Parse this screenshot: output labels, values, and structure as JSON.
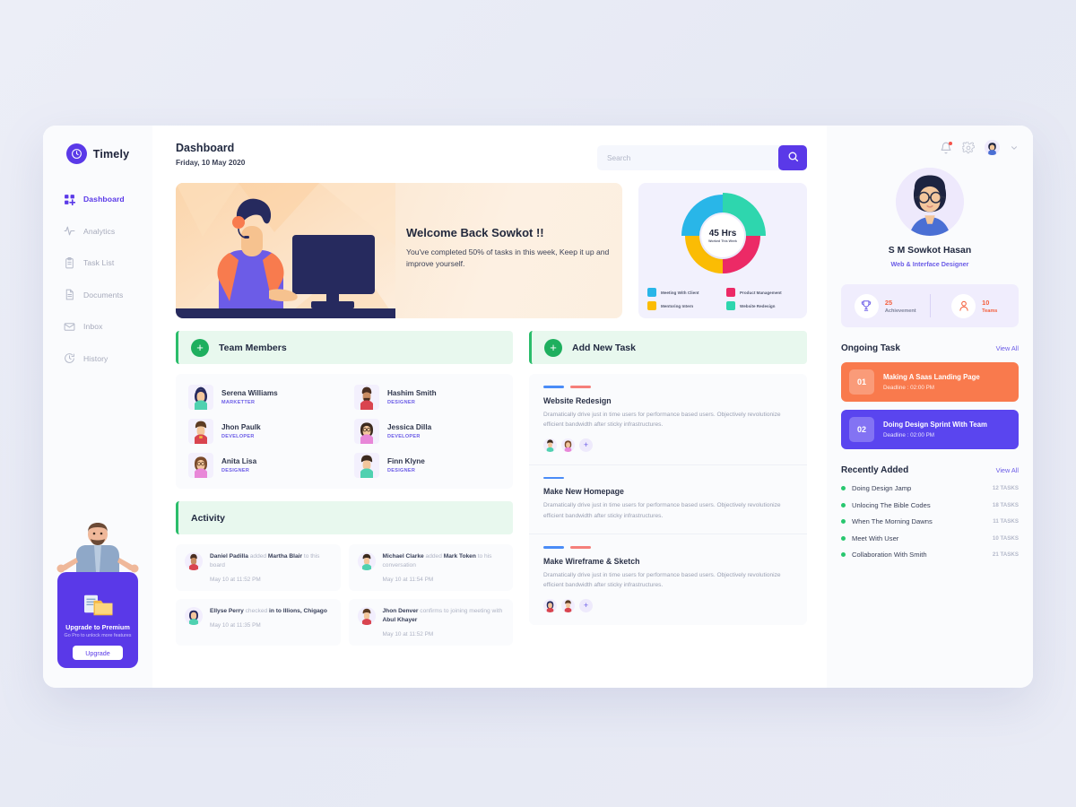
{
  "brand": {
    "name": "Timely",
    "logo_icon": "clock-icon",
    "color": "#5a39e8"
  },
  "sidebar": {
    "items": [
      {
        "label": "Dashboard",
        "icon": "grid-add-icon",
        "active": true
      },
      {
        "label": "Analytics",
        "icon": "pulse-icon",
        "active": false
      },
      {
        "label": "Task List",
        "icon": "clipboard-icon",
        "active": false
      },
      {
        "label": "Documents",
        "icon": "document-icon",
        "active": false
      },
      {
        "label": "Inbox",
        "icon": "envelope-icon",
        "active": false
      },
      {
        "label": "History",
        "icon": "history-clock-icon",
        "active": false
      }
    ],
    "upgrade": {
      "title": "Upgrade to Premium",
      "subtitle": "Go Pro to unlock more features",
      "button": "Upgrade",
      "illustration": "shrugging-man-illustration",
      "icon": "folder-documents-icon"
    }
  },
  "header": {
    "title": "Dashboard",
    "date": "Friday, 10 May 2020",
    "search": {
      "placeholder": "Search",
      "value": "",
      "button_icon": "search-icon"
    }
  },
  "welcome": {
    "heading": "Welcome Back Sowkot !!",
    "body": "You've completed 50% of tasks in this week, Keep it up and improve yourself.",
    "illustration": "man-at-computer-illustration"
  },
  "chart_data": {
    "type": "pie",
    "title": "45 Hrs",
    "subtitle": "Worked This Week",
    "center_value": "45 Hrs",
    "center_label": "Worked This Week",
    "categories": [
      "Meeting With Client",
      "Mentoring Intern",
      "Product Management",
      "Website Redesign"
    ],
    "values": [
      25,
      25,
      25,
      25
    ],
    "colors": [
      "#29b6e8",
      "#fbbc04",
      "#ec2a66",
      "#2ed6ae"
    ],
    "legend_position": "bottom",
    "grid": false,
    "donut": true
  },
  "team": {
    "section_title": "Team Members",
    "add_icon": "plus-icon",
    "members": [
      {
        "name": "Serena Williams",
        "role": "MARKETTER",
        "avatar": "avatar-female-teal"
      },
      {
        "name": "Hashim Smith",
        "role": "DESIGNER",
        "avatar": "avatar-male-red-beard"
      },
      {
        "name": "Jhon Paulk",
        "role": "DEVELOPER",
        "avatar": "avatar-male-red"
      },
      {
        "name": "Jessica Dilla",
        "role": "DEVELOPER",
        "avatar": "avatar-female-pink-glasses"
      },
      {
        "name": "Anita Lisa",
        "role": "DESIGNER",
        "avatar": "avatar-female-pink"
      },
      {
        "name": "Finn Klyne",
        "role": "DESIGNER",
        "avatar": "avatar-male-teal"
      }
    ]
  },
  "activity": {
    "section_title": "Activity",
    "items": [
      {
        "actor": "Daniel Padilla",
        "action": "added",
        "target": "Martha Blair",
        "suffix": "to this board",
        "time": "May 10 at 11:52 PM",
        "avatar": "avatar-male-red-beard"
      },
      {
        "actor": "Michael Clarke",
        "action": "added",
        "target": "Mark Token",
        "suffix": "to his conversation",
        "time": "May 10 at 11:54 PM",
        "avatar": "avatar-male-teal"
      },
      {
        "actor": "Ellyse Perry",
        "action": "checked",
        "target": "in to Illions, Chigago",
        "suffix": "",
        "time": "May 10 at 11:35 PM",
        "avatar": "avatar-female-teal"
      },
      {
        "actor": "Jhon Denver",
        "action": "confirms to joining meeting with",
        "target": "Abul Khayer",
        "suffix": "",
        "time": "May 10 at 11:52 PM",
        "avatar": "avatar-male-red"
      }
    ]
  },
  "tasks": {
    "section_title": "Add New Task",
    "add_icon": "plus-icon",
    "items": [
      {
        "title": "Website Redesign",
        "desc": "Dramatically drive just in time users for performance based users. Objectively revolutionize efficient bandwidth after sticky infrastructures.",
        "tags": [
          "#4a8cf7",
          "#f57f7a"
        ],
        "avatars": [
          "avatar-male-teal",
          "avatar-female-pink"
        ],
        "add_label": "+"
      },
      {
        "title": "Make New Homepage",
        "desc": "Dramatically drive just in time users for performance based users. Objectively revolutionize efficient bandwidth after sticky infrastructures.",
        "tags": [
          "#4a8cf7"
        ],
        "avatars": [],
        "add_label": "+"
      },
      {
        "title": "Make Wireframe & Sketch",
        "desc": "Dramatically drive just in time users for performance based users. Objectively revolutionize efficient bandwidth after sticky infrastructures.",
        "tags": [
          "#4a8cf7",
          "#f57f7a"
        ],
        "avatars": [
          "avatar-female-red",
          "avatar-male-red"
        ],
        "add_label": "+"
      }
    ]
  },
  "right_panel": {
    "icons": {
      "bell": "bell-icon",
      "settings": "gear-icon",
      "avatar": "user-avatar",
      "chevron": "chevron-down-icon",
      "has_notification": true
    },
    "profile": {
      "name": "S M Sowkot Hasan",
      "role": "Web & Interface Designer",
      "avatar": "avatar-man-glasses-blue"
    },
    "stats": [
      {
        "value": "25",
        "label": "Achievement",
        "icon": "trophy-icon",
        "color": "#6b5ce7"
      },
      {
        "value": "10",
        "label": "Teams",
        "icon": "person-icon",
        "color": "#f4603e"
      }
    ],
    "ongoing": {
      "title": "Ongoing Task",
      "view_all": "View All",
      "items": [
        {
          "num": "01",
          "title": "Making A Saas Landing Page",
          "deadline": "Deadline : 02:00 PM",
          "color": "#f97a4d"
        },
        {
          "num": "02",
          "title": "Doing Design Sprint With Team",
          "deadline": "Deadline : 02:00 PM",
          "color": "#5a45ef"
        }
      ]
    },
    "recent": {
      "title": "Recently Added",
      "view_all": "View All",
      "items": [
        {
          "label": "Doing Design Jamp",
          "count": "12 TASKS"
        },
        {
          "label": "Unlocing The Bible Codes",
          "count": "18 TASKS"
        },
        {
          "label": "When The Morning Dawns",
          "count": "11 TASKS"
        },
        {
          "label": "Meet With User",
          "count": "10 TASKS"
        },
        {
          "label": "Collaboration With Smith",
          "count": "21 TASKS"
        }
      ]
    }
  }
}
